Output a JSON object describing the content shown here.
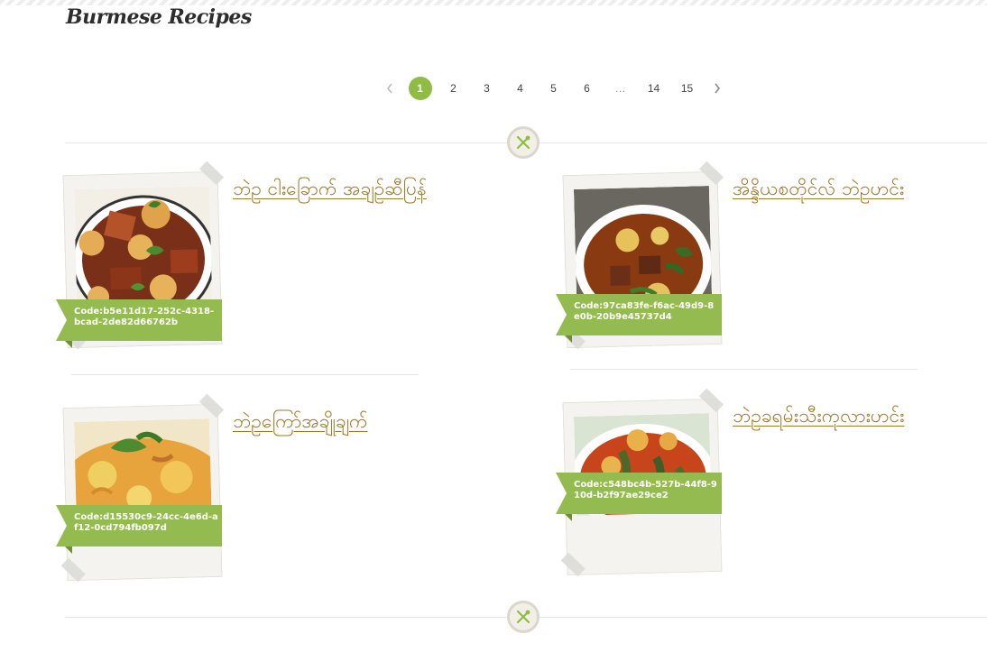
{
  "page": {
    "title": "Burmese Recipes"
  },
  "pagination": {
    "prev_icon": "chevron-left-icon",
    "next_icon": "chevron-right-icon",
    "pages": [
      "1",
      "2",
      "3",
      "4",
      "5",
      "6",
      "…",
      "14",
      "15"
    ],
    "current": "1"
  },
  "divider": {
    "icon": "fork-spoon-icon"
  },
  "recipes": [
    {
      "title": "ဘဲဥ ငါးခြောက် အချဉ်ဆီပြန်",
      "code": "Code:b5e11d17-252c-4318-bcad-2de82d66762b"
    },
    {
      "title": "အိန္ဒိယစတိုင်လ် ဘဲဥဟင်း",
      "code": "Code:97ca83fe-f6ac-49d9-8e0b-20b9e45737d4"
    },
    {
      "title": "ဘဲဥကြော်အချိုချက်",
      "code": "Code:d15530c9-24cc-4e6d-af12-0cd794fb097d"
    },
    {
      "title": "ဘဲဥခရမ်းသီးကုလားဟင်း",
      "code": "Code:c548bc4b-527b-44f8-910d-b2f97ae29ce2"
    }
  ],
  "colors": {
    "accent": "#94bb4f",
    "link": "#a07a2a"
  }
}
